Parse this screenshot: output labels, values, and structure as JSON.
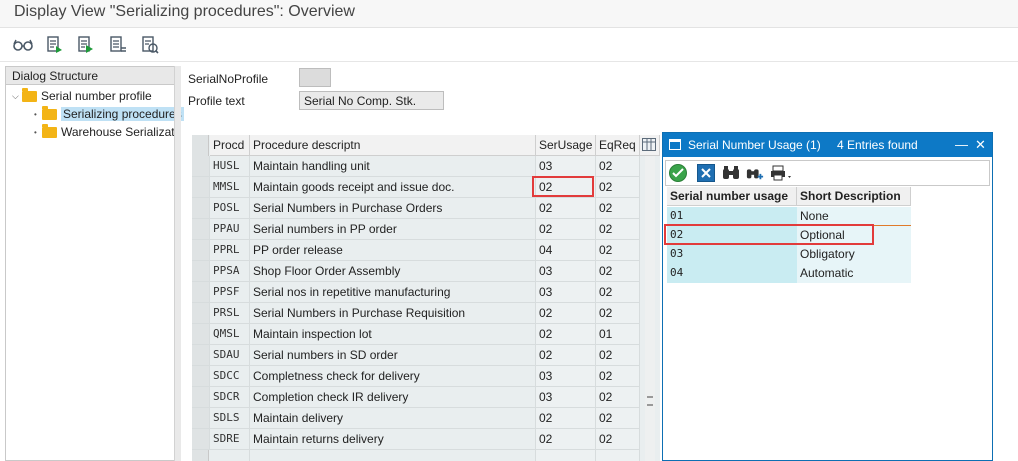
{
  "title": "Display View \"Serializing procedures\": Overview",
  "toolbar": {
    "buttons": [
      "glasses-icon",
      "display-document-icon",
      "next-document-icon",
      "document-list-icon",
      "compare-icon"
    ]
  },
  "dialog_structure": {
    "header": "Dialog Structure",
    "items": [
      {
        "label": "Serial number profile",
        "level": 0,
        "expanded": true
      },
      {
        "label": "Serializing procedures",
        "level": 1,
        "selected": true
      },
      {
        "label": "Warehouse Serializati",
        "level": 1
      }
    ]
  },
  "fields": {
    "serial_profile_label": "SerialNoProfile",
    "serial_profile_value": "",
    "profile_text_label": "Profile text",
    "profile_text_value": "Serial No Comp. Stk."
  },
  "table": {
    "headers": {
      "procd": "Procd",
      "desc": "Procedure descriptn",
      "ser": "SerUsage",
      "eq": "EqReq"
    },
    "rows": [
      {
        "procd": "HUSL",
        "desc": "Maintain handling unit",
        "ser": "03",
        "eq": "02"
      },
      {
        "procd": "MMSL",
        "desc": "Maintain goods receipt and issue doc.",
        "ser": "02",
        "eq": "02"
      },
      {
        "procd": "POSL",
        "desc": "Serial Numbers in Purchase Orders",
        "ser": "02",
        "eq": "02"
      },
      {
        "procd": "PPAU",
        "desc": "Serial numbers in PP order",
        "ser": "02",
        "eq": "02"
      },
      {
        "procd": "PPRL",
        "desc": "PP order release",
        "ser": "04",
        "eq": "02"
      },
      {
        "procd": "PPSA",
        "desc": "Shop Floor Order Assembly",
        "ser": "03",
        "eq": "02"
      },
      {
        "procd": "PPSF",
        "desc": "Serial nos in repetitive manufacturing",
        "ser": "03",
        "eq": "02"
      },
      {
        "procd": "PRSL",
        "desc": "Serial Numbers in Purchase Requisition",
        "ser": "02",
        "eq": "02"
      },
      {
        "procd": "QMSL",
        "desc": "Maintain inspection lot",
        "ser": "02",
        "eq": "01"
      },
      {
        "procd": "SDAU",
        "desc": "Serial numbers in SD order",
        "ser": "02",
        "eq": "02"
      },
      {
        "procd": "SDCC",
        "desc": "Completness check for delivery",
        "ser": "03",
        "eq": "02"
      },
      {
        "procd": "SDCR",
        "desc": "Completion check IR delivery",
        "ser": "03",
        "eq": "02"
      },
      {
        "procd": "SDLS",
        "desc": "Maintain delivery",
        "ser": "02",
        "eq": "02"
      },
      {
        "procd": "SDRE",
        "desc": "Maintain returns delivery",
        "ser": "02",
        "eq": "02"
      }
    ]
  },
  "popup": {
    "title": "Serial Number Usage (1)",
    "entries_found": "4 Entries found",
    "minimize": "—",
    "close": "✕",
    "headers": {
      "key": "Serial number usage",
      "desc": "Short Description"
    },
    "rows": [
      {
        "key": "01",
        "desc": "None"
      },
      {
        "key": "02",
        "desc": "Optional"
      },
      {
        "key": "03",
        "desc": "Obligatory"
      },
      {
        "key": "04",
        "desc": "Automatic"
      }
    ]
  },
  "colors": {
    "highlight": "#e23b3b",
    "popup_header": "#0d79c6",
    "folder": "#f3b416",
    "selection": "#bfe1f5"
  }
}
